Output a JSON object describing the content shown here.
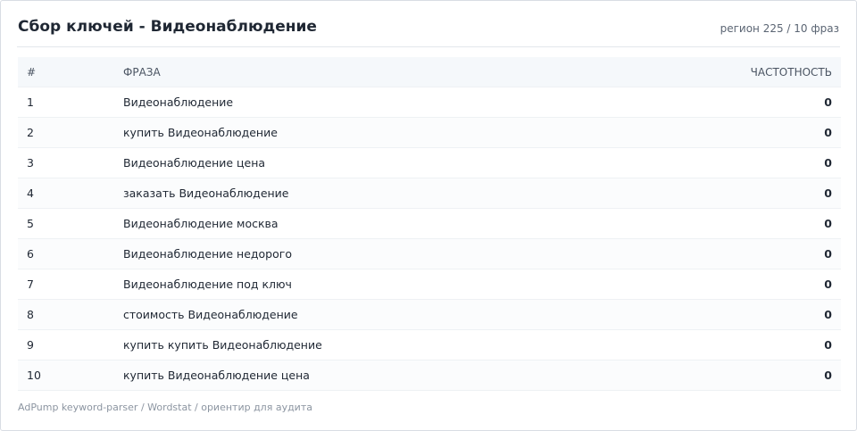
{
  "header": {
    "title": "Сбор ключей - Видеонаблюдение",
    "meta": "регион 225 / 10 фраз"
  },
  "table": {
    "columns": {
      "num": "#",
      "phrase": "ФРАЗА",
      "frequency": "ЧАСТОТНОСТЬ"
    },
    "rows": [
      {
        "num": "1",
        "phrase": "Видеонаблюдение",
        "frequency": "0"
      },
      {
        "num": "2",
        "phrase": "купить Видеонаблюдение",
        "frequency": "0"
      },
      {
        "num": "3",
        "phrase": "Видеонаблюдение цена",
        "frequency": "0"
      },
      {
        "num": "4",
        "phrase": "заказать Видеонаблюдение",
        "frequency": "0"
      },
      {
        "num": "5",
        "phrase": "Видеонаблюдение москва",
        "frequency": "0"
      },
      {
        "num": "6",
        "phrase": "Видеонаблюдение недорого",
        "frequency": "0"
      },
      {
        "num": "7",
        "phrase": "Видеонаблюдение под ключ",
        "frequency": "0"
      },
      {
        "num": "8",
        "phrase": "стоимость Видеонаблюдение",
        "frequency": "0"
      },
      {
        "num": "9",
        "phrase": "купить купить Видеонаблюдение",
        "frequency": "0"
      },
      {
        "num": "10",
        "phrase": "купить Видеонаблюдение цена",
        "frequency": "0"
      }
    ]
  },
  "footer": {
    "text": "AdPump keyword-parser / Wordstat / ориентир для аудита"
  }
}
